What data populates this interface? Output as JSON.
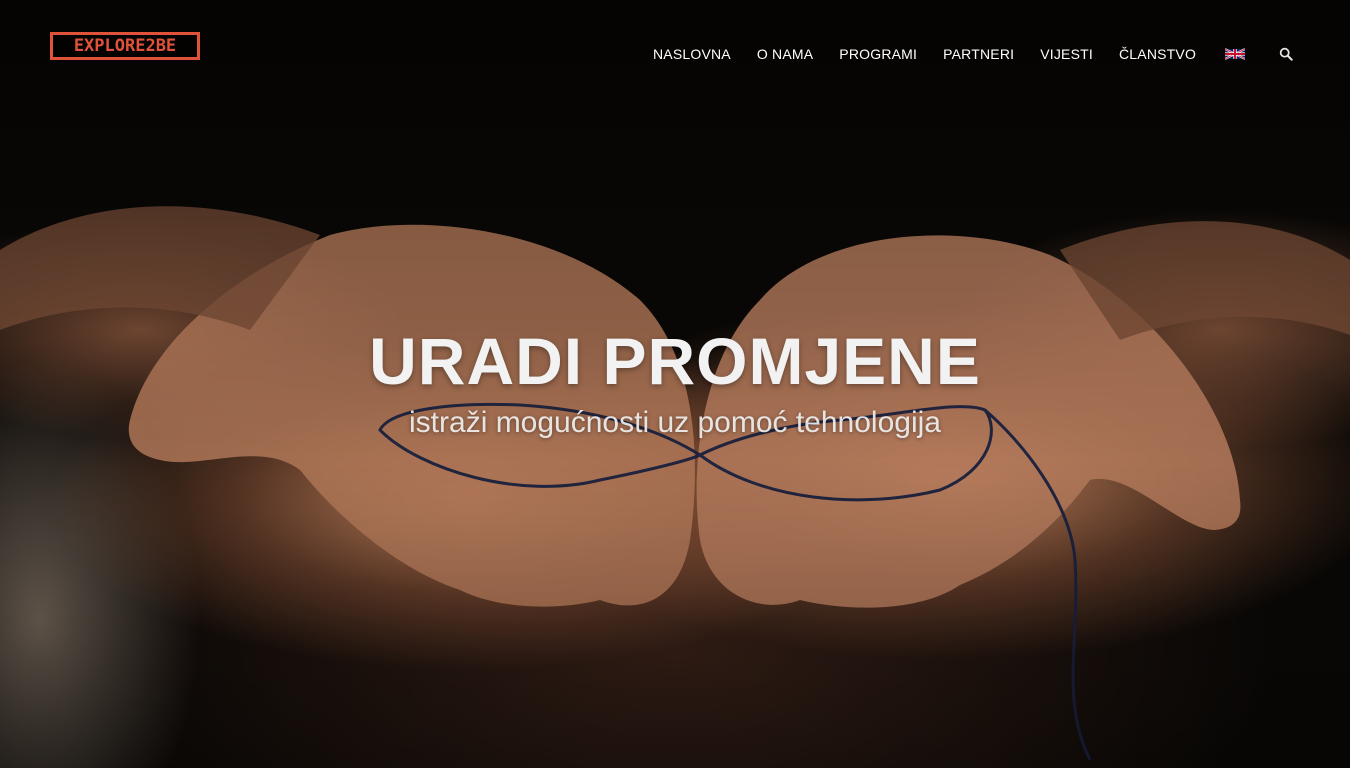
{
  "logo": {
    "text": "EXPLORE2BE"
  },
  "nav": {
    "items": [
      {
        "label": "NASLOVNA"
      },
      {
        "label": "O NAMA"
      },
      {
        "label": "PROGRAMI"
      },
      {
        "label": "PARTNERI"
      },
      {
        "label": "VIJESTI"
      },
      {
        "label": "ČLANSTVO"
      }
    ],
    "language_icon": "uk-flag-icon",
    "search_icon": "search-icon"
  },
  "hero": {
    "title": "URADI PROMJENE",
    "subtitle": "istraži mogućnosti uz pomoć tehnologija",
    "image_icon": "open-hands-with-thread-photo"
  },
  "colors": {
    "brand": "#e0533a",
    "text": "#ffffff",
    "background": "#0b0907"
  }
}
